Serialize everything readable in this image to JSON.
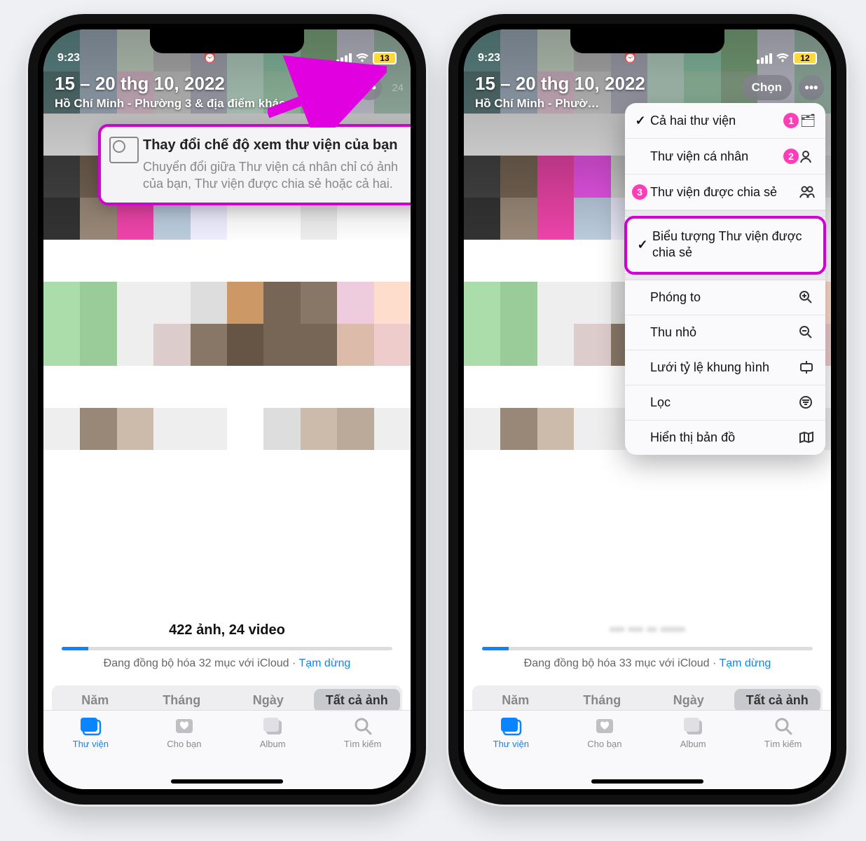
{
  "status": {
    "time": "9:23",
    "signal_reminder": "⏰",
    "battery_left": "13",
    "battery_right": "12"
  },
  "header": {
    "date_range": "15 – 20 thg 10, 2022",
    "location": "Hồ Chí Minh - Phường 3 & địa điểm khác",
    "location_short": "Hồ Chí Minh - Phườ…",
    "select_label": "Chọn",
    "count_badge": "24"
  },
  "tooltip": {
    "title": "Thay đổi chế độ xem thư viện của bạn",
    "body": "Chuyển đổi giữa Thư viện cá nhân chỉ có ảnh của bạn, Thư viện được chia sẻ hoặc cả hai."
  },
  "summary": {
    "count_text": "422 ảnh, 24 video",
    "sync_text_left": "Đang đồng bộ hóa 32 mục với iCloud · ",
    "sync_text_right": "Đang đồng bộ hóa 33 mục với iCloud · ",
    "pause": "Tạm dừng"
  },
  "segments": {
    "year": "Năm",
    "month": "Tháng",
    "day": "Ngày",
    "all": "Tất cả ảnh"
  },
  "tabs": {
    "library": "Thư viện",
    "foryou": "Cho bạn",
    "albums": "Album",
    "search": "Tìm kiếm"
  },
  "menu": {
    "both": "Cả hai thư viện",
    "personal": "Thư viện cá nhân",
    "shared": "Thư viện được chia sẻ",
    "badge_icon": "Biểu tượng Thư viện được chia sẻ",
    "zoom_in": "Phóng to",
    "zoom_out": "Thu nhỏ",
    "aspect": "Lưới tỷ lệ khung hình",
    "filter": "Lọc",
    "map": "Hiển thị bản đồ",
    "n1": "1",
    "n2": "2",
    "n3": "3"
  }
}
